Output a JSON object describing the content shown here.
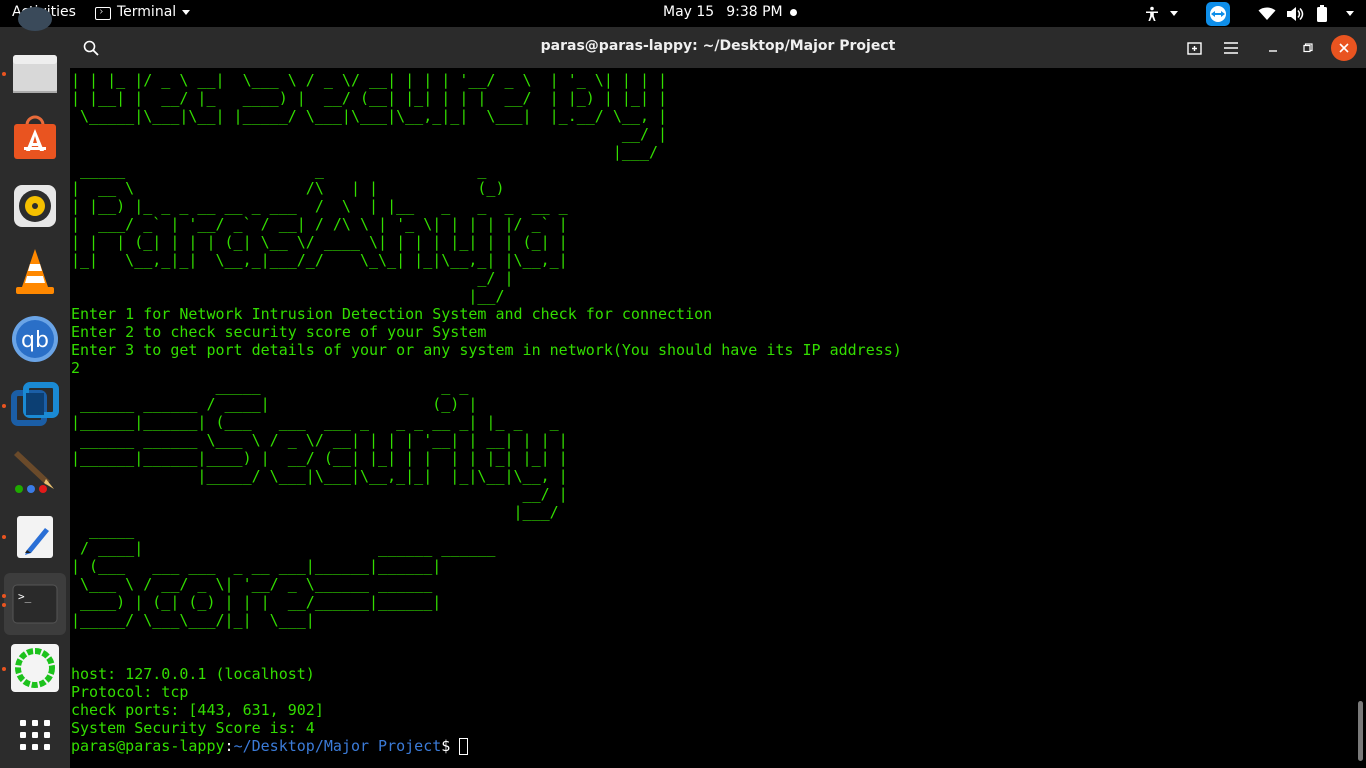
{
  "topbar": {
    "activities": "Activities",
    "app_name": "Terminal",
    "date": "May 15",
    "time": "9:38 PM"
  },
  "window": {
    "title": "paras@paras-lappy: ~/Desktop/Major Project"
  },
  "terminal": {
    "lines": [
      "| | |_ |/ _ \\ __|  \\___ \\ / _ \\/ __| | | | '__/ _ \\  | '_ \\| | | |",
      "| |__| |  __/ |_   ____) |  __/ (__| |_| | | |  __/  | |_) | |_| |",
      " \\_____|\\___|\\__| |_____/ \\___|\\___|\\__,_|_|  \\___|  |_.__/ \\__, |",
      "                                                             __/ |",
      "                                                            |___/",
      " _____                     _                 _",
      "|  __ \\                   /\\   | |           (_)",
      "| |__) |_ _ _ __ __ _ ___  /  \\  | |__   _   _  _  __ _",
      "|  ___/ _` | '__/ _` / __| / /\\ \\ | '_ \\| | | | |/ _` |",
      "| |  | (_| | | | (_| \\__ \\/ ____ \\| | | | |_| | | (_| |",
      "|_|   \\__,_|_|  \\__,_|___/_/    \\_\\_| |_|\\__,_| |\\__,_|",
      "                                             _/ |",
      "                                            |__/",
      "Enter 1 for Network Intrusion Detection System and check for connection",
      "Enter 2 to check security score of your System",
      "Enter 3 to get port details of your or any system in network(You should have its IP address)",
      "2",
      "                _____                    _ _",
      " ______ ______ / ____|                  (_) |",
      "|______|______| (___   ___  ___ _   _ _ __ _| |_ _   _",
      " ______ ______ \\___ \\ / _ \\/ __| | | | '__| | __| | | |",
      "|______|______|____) |  __/ (__| |_| | |  | | |_| |_| |",
      "              |_____/ \\___|\\___|\\__,_|_|  |_|\\__|\\__, |",
      "                                                  __/ |",
      "                                                 |___/",
      "  _____",
      " / ____|                          ______ ______",
      "| (___   ___ ___  _ __ ___|______|______|",
      " \\___ \\ / __/ _ \\| '__/ _ \\______ ______",
      " ____) | (_| (_) | | |  __/______|______|",
      "|_____/ \\___\\___/|_|  \\___|",
      "",
      "",
      "host: 127.0.0.1 (localhost)",
      "Protocol: tcp",
      "check ports: [443, 631, 902]",
      "System Security Score is: 4"
    ],
    "prompt_user": "paras@paras-lappy",
    "prompt_sep": ":",
    "prompt_path": "~/Desktop/Major Project",
    "prompt_symbol": "$ "
  },
  "dock": {
    "items": [
      "files-icon",
      "ubuntu-software-icon",
      "rhythmbox-icon",
      "vlc-icon",
      "qbittorrent-icon",
      "virtualbox-icon",
      "inkscape-icon",
      "text-editor-icon",
      "terminal-icon",
      "cinnamon-icon",
      "show-apps-icon"
    ]
  },
  "colors": {
    "terminal_fg": "#33dd00",
    "terminal_bg": "#000000",
    "prompt_path": "#3b7bd8",
    "accent": "#e95420"
  }
}
